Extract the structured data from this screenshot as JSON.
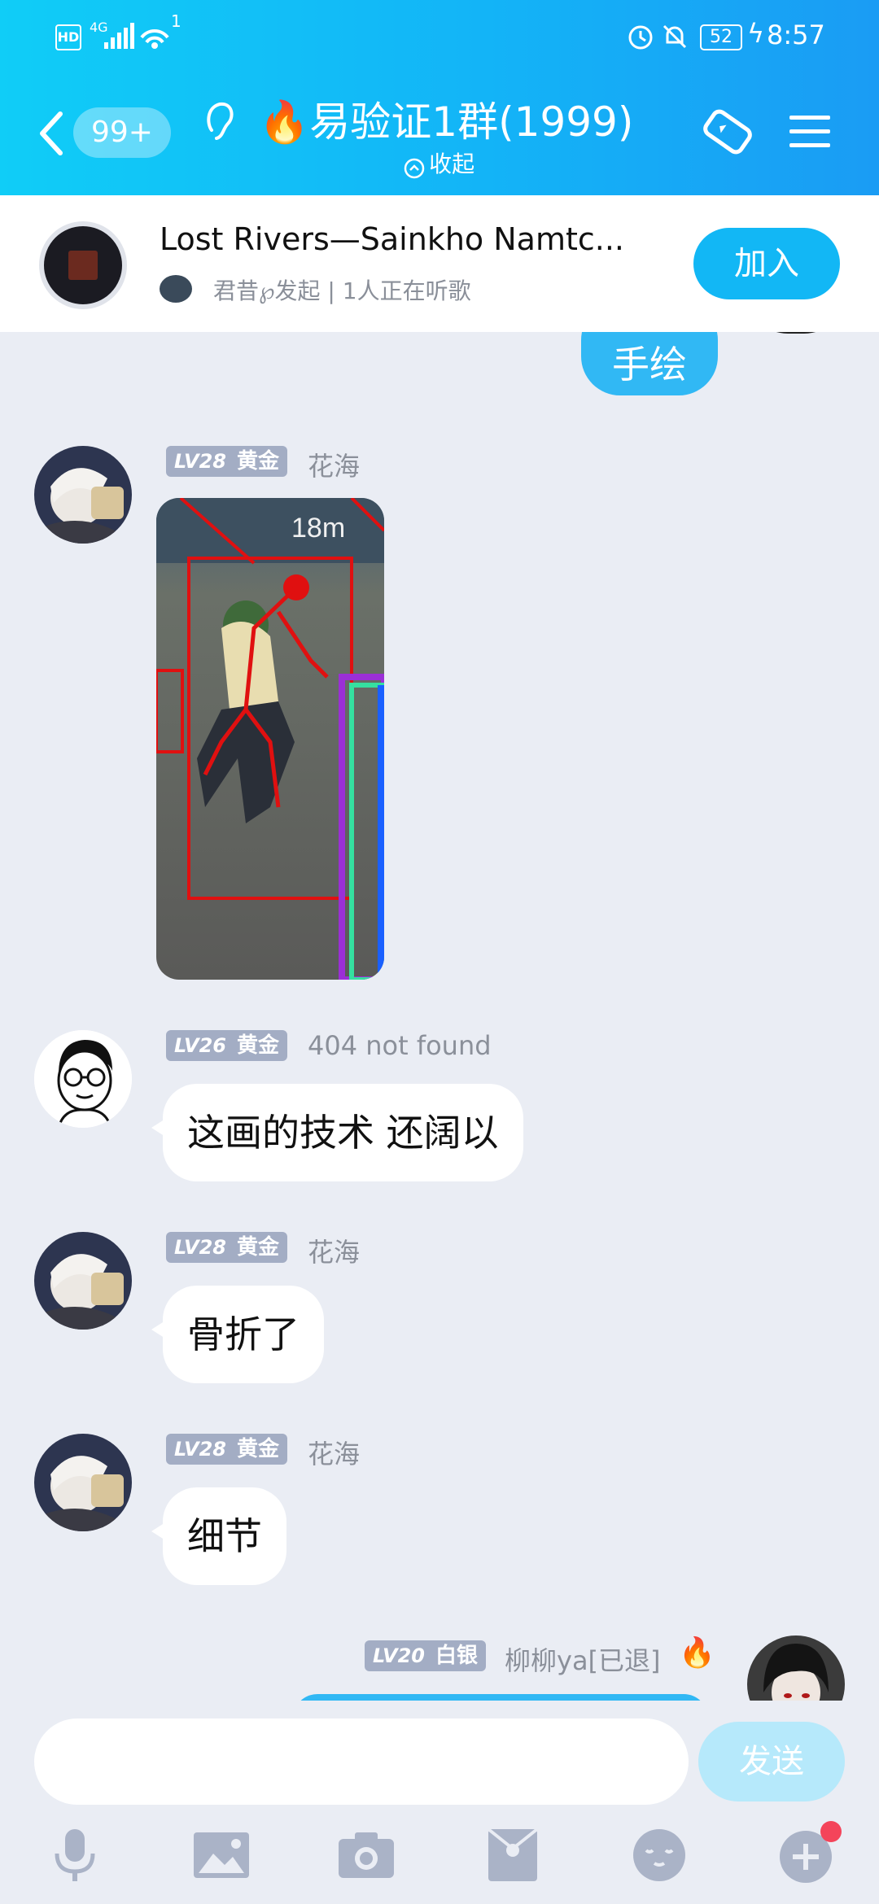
{
  "status_bar": {
    "network": "4G",
    "notification_count": "1",
    "battery": "52",
    "time": "8:57"
  },
  "header": {
    "unread_badge": "99+",
    "group_title": "🔥易验证1群(1999)",
    "collapse_label": "收起"
  },
  "music_bar": {
    "song_title": "Lost Rivers—Sainkho Namtc...",
    "initiator_text": "君昔℘发起 | 1人正在听歌",
    "join_label": "加入"
  },
  "messages": [
    {
      "type": "outgoing_partial",
      "text": "手绘"
    },
    {
      "type": "image",
      "level": "LV28",
      "rank": "黄金",
      "nickname": "花海",
      "image_label": "18m"
    },
    {
      "type": "text",
      "level": "LV26",
      "rank": "黄金",
      "nickname": "404 not found",
      "text": "这画的技术 还阔以"
    },
    {
      "type": "text",
      "level": "LV28",
      "rank": "黄金",
      "nickname": "花海",
      "text": "骨折了"
    },
    {
      "type": "text",
      "level": "LV28",
      "rank": "黄金",
      "nickname": "花海",
      "text": "细节"
    },
    {
      "type": "outgoing_header",
      "level": "LV20",
      "rank": "白银",
      "nickname": "柳柳ya[已退]"
    }
  ],
  "input_bar": {
    "placeholder": "",
    "send_label": "发送",
    "tools": [
      "microphone-icon",
      "image-icon",
      "camera-icon",
      "red-packet-icon",
      "emoji-icon",
      "plus-icon"
    ]
  },
  "colors": {
    "header_start": "#10cdf7",
    "header_end": "#1a9cf4",
    "accent": "#12b7f5",
    "chat_bg": "#eaedf4",
    "badge_bg": "#a3adc4"
  }
}
